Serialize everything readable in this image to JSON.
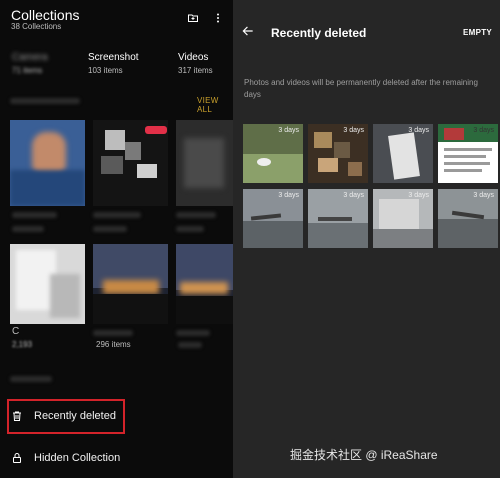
{
  "collections": {
    "title": "Collections",
    "subtitle": "38 Collections",
    "albums": [
      {
        "label": "Camera",
        "count": "71 items"
      },
      {
        "label": "Screenshot",
        "count": "103 items"
      },
      {
        "label": "Videos",
        "count": "317 items"
      }
    ],
    "view_all": "VIEW ALL",
    "thumbs_row2": [
      {
        "label": "C",
        "count": "2,193"
      },
      {
        "label": "",
        "count": "296 items"
      },
      {
        "label": "",
        "count": ""
      }
    ],
    "recently_deleted_label": "Recently deleted",
    "hidden_collection_label": "Hidden Collection",
    "icons": {
      "add": "add-folder-icon",
      "more": "more-vert-icon",
      "trash": "trash-icon",
      "lock": "lock-icon"
    },
    "colors": {
      "highlight": "#d3232a",
      "accent": "#c9a02c"
    }
  },
  "recently_deleted": {
    "title": "Recently deleted",
    "empty_label": "EMPTY",
    "notice": "Photos and videos will be permanently deleted after the remaining days",
    "items": [
      {
        "days": "3 days"
      },
      {
        "days": "3 days"
      },
      {
        "days": "3 days"
      },
      {
        "days": "3 days"
      },
      {
        "days": "3 days"
      },
      {
        "days": "3 days"
      },
      {
        "days": "3 days"
      },
      {
        "days": "3 days"
      }
    ]
  },
  "watermark": "掘金技术社区 @ iReaShare"
}
